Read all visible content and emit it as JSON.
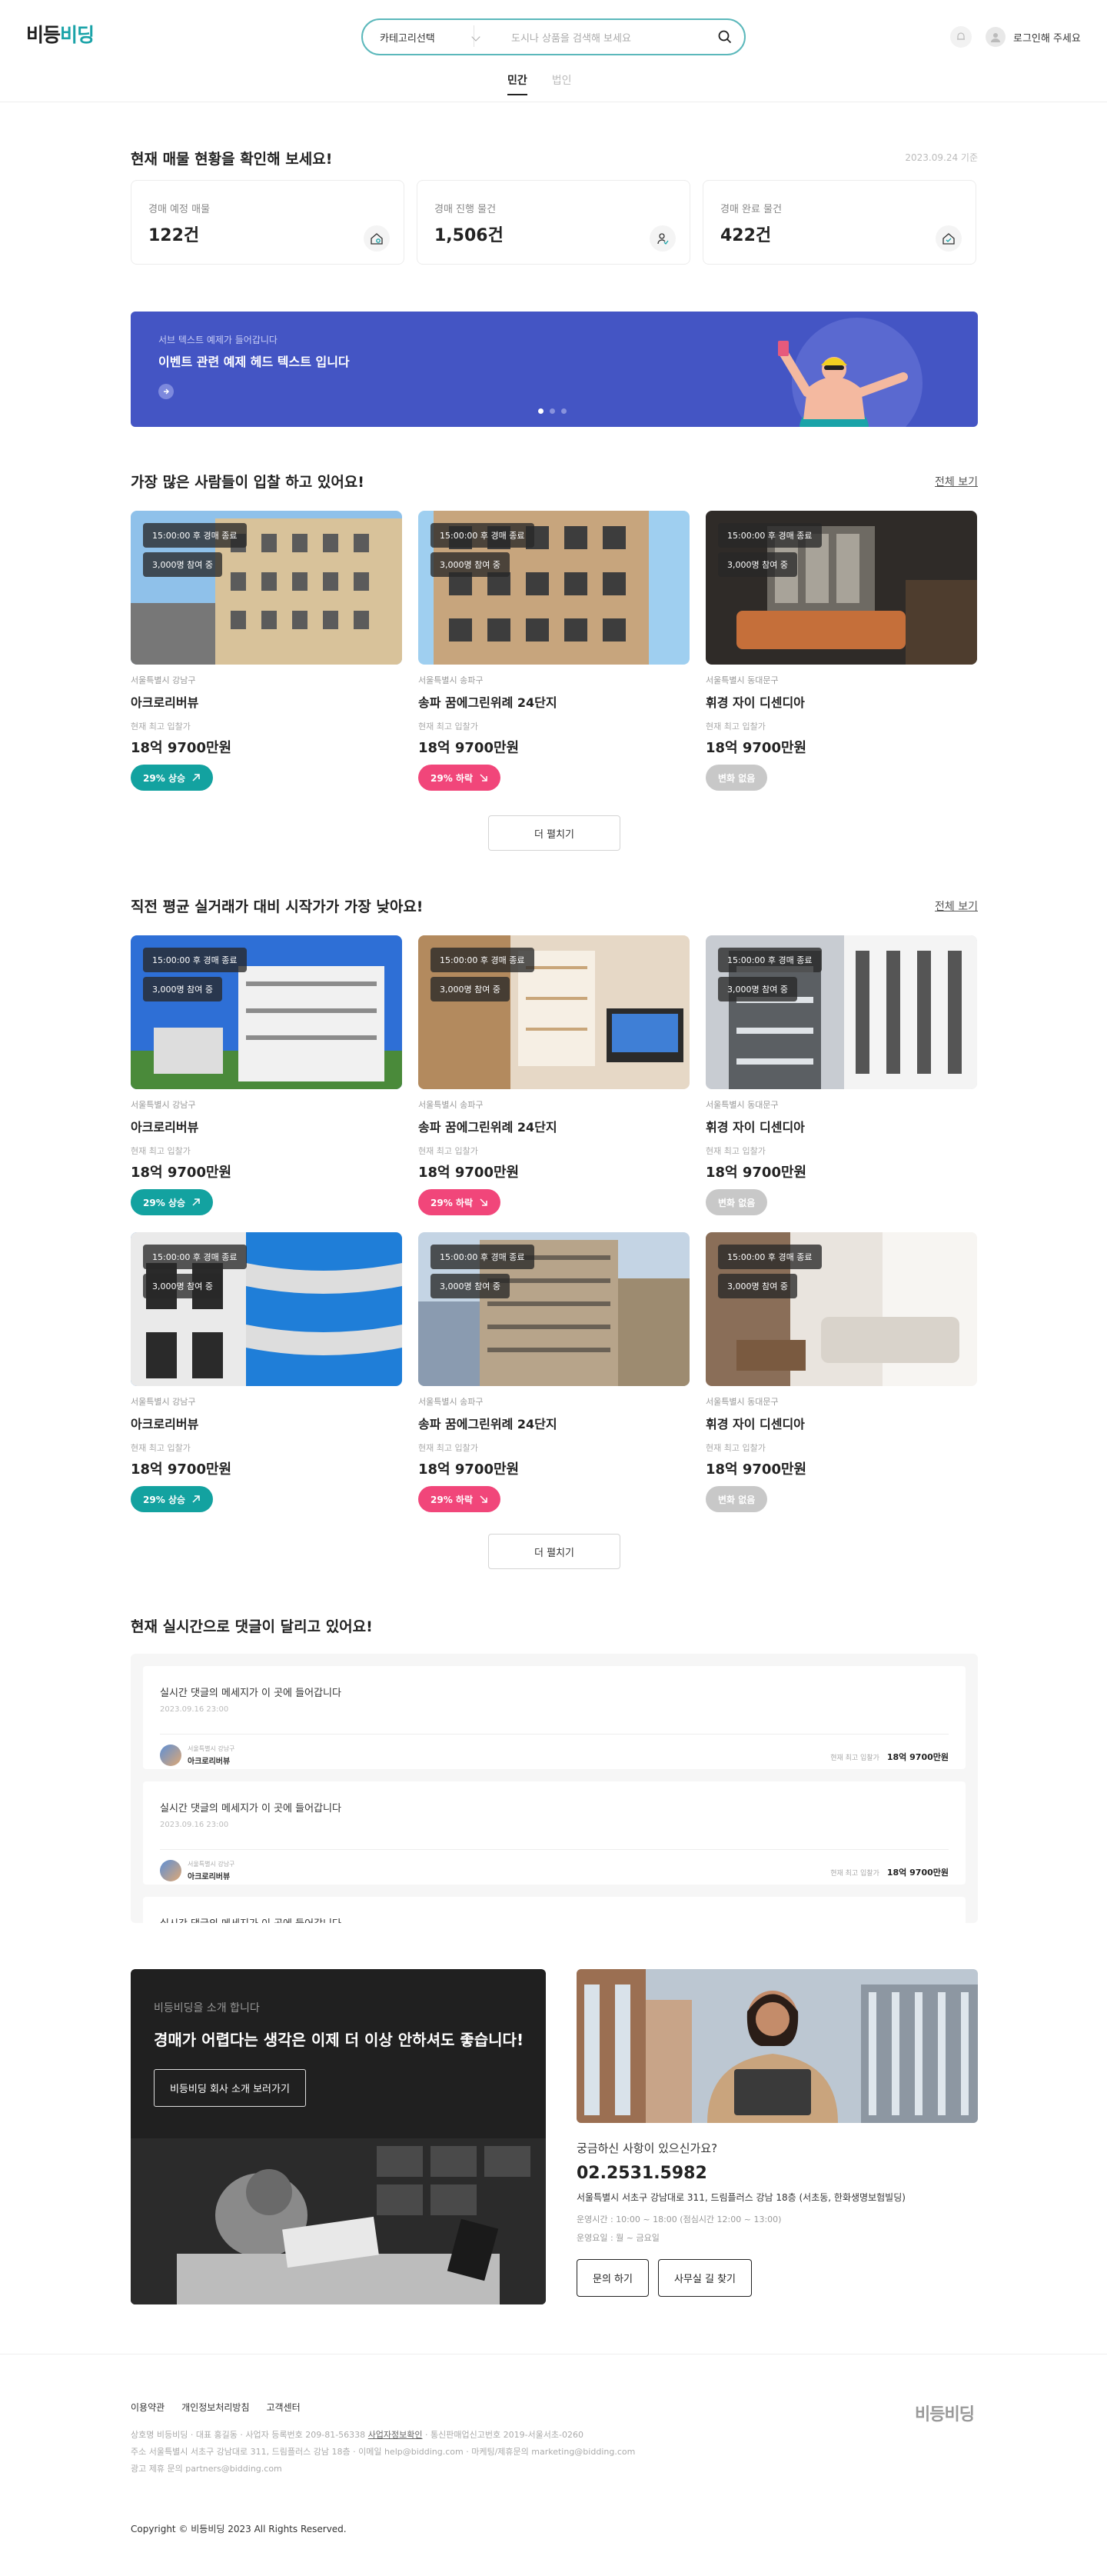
{
  "header": {
    "logo_left": "비등",
    "logo_right": "비딩",
    "category_label": "카테고리선택",
    "search_placeholder": "도시나 상품을 검색해 보세요",
    "login_label": "로그인해 주세요"
  },
  "tabs": [
    {
      "label": "민간",
      "active": true
    },
    {
      "label": "법인",
      "active": false
    }
  ],
  "stats": {
    "title": "현재 매물 현황을 확인해 보세요!",
    "date": "2023.09.24 기준",
    "cards": [
      {
        "label": "경매 예정 매물",
        "value": "122건",
        "icon": "house-search-icon"
      },
      {
        "label": "경매 진행 물건",
        "value": "1,506건",
        "icon": "user-check-icon"
      },
      {
        "label": "경매 완료 물건",
        "value": "422건",
        "icon": "house-check-icon"
      }
    ]
  },
  "banner": {
    "subtitle": "서브 텍스트 예제가 들어갑니다",
    "title": "이벤트 관련 예제 헤드 텍스트 입니다",
    "accent_color": "#4455c4"
  },
  "popular": {
    "title": "가장 많은 사람들이 입찰 하고 있어요!",
    "more": "전체 보기",
    "load_more": "더 펼치기",
    "items": [
      {
        "time": "15:00:00 후 경매 종료",
        "count": "3,000명 참여 중",
        "location": "서울특별시 강남구",
        "name": "아크로리버뷰",
        "price_label": "현재 최고 입찰가",
        "price": "18억 9700만원",
        "change": "29% 상승",
        "trend": "up"
      },
      {
        "time": "15:00:00 후 경매 종료",
        "count": "3,000명 참여 중",
        "location": "서울특별시 송파구",
        "name": "송파 꿈에그린위례 24단지",
        "price_label": "현재 최고 입찰가",
        "price": "18억 9700만원",
        "change": "29% 하락",
        "trend": "down"
      },
      {
        "time": "15:00:00 후 경매 종료",
        "count": "3,000명 참여 중",
        "location": "서울특별시 동대문구",
        "name": "휘경 자이 디센디아",
        "price_label": "현재 최고 입찰가",
        "price": "18억 9700만원",
        "change": "변화 없음",
        "trend": "none"
      }
    ]
  },
  "lowest": {
    "title": "직전 평균 실거래가 대비 시작가가 가장 낮아요!",
    "more": "전체 보기",
    "load_more": "더 펼치기",
    "items": [
      {
        "time": "15:00:00 후 경매 종료",
        "count": "3,000명 참여 중",
        "location": "서울특별시 강남구",
        "name": "아크로리버뷰",
        "price_label": "현재 최고 입찰가",
        "price": "18억 9700만원",
        "change": "29% 상승",
        "trend": "up"
      },
      {
        "time": "15:00:00 후 경매 종료",
        "count": "3,000명 참여 중",
        "location": "서울특별시 송파구",
        "name": "송파 꿈에그린위례 24단지",
        "price_label": "현재 최고 입찰가",
        "price": "18억 9700만원",
        "change": "29% 하락",
        "trend": "down"
      },
      {
        "time": "15:00:00 후 경매 종료",
        "count": "3,000명 참여 중",
        "location": "서울특별시 동대문구",
        "name": "휘경 자이 디센디아",
        "price_label": "현재 최고 입찰가",
        "price": "18억 9700만원",
        "change": "변화 없음",
        "trend": "none"
      },
      {
        "time": "15:00:00 후 경매 종료",
        "count": "3,000명 참여 중",
        "location": "서울특별시 강남구",
        "name": "아크로리버뷰",
        "price_label": "현재 최고 입찰가",
        "price": "18억 9700만원",
        "change": "29% 상승",
        "trend": "up"
      },
      {
        "time": "15:00:00 후 경매 종료",
        "count": "3,000명 참여 중",
        "location": "서울특별시 송파구",
        "name": "송파 꿈에그린위례 24단지",
        "price_label": "현재 최고 입찰가",
        "price": "18억 9700만원",
        "change": "29% 하락",
        "trend": "down"
      },
      {
        "time": "15:00:00 후 경매 종료",
        "count": "3,000명 참여 중",
        "location": "서울특별시 동대문구",
        "name": "휘경 자이 디센디아",
        "price_label": "현재 최고 입찰가",
        "price": "18억 9700만원",
        "change": "변화 없음",
        "trend": "none"
      }
    ]
  },
  "live": {
    "title": "현재 실시간으로 댓글이 달리고 있어요!",
    "comments": [
      {
        "text": "실시간 댓글의 메세지가 이 곳에 들어갑니다",
        "date": "2023.09.16 23:00",
        "user_location": "서울특별시 강남구",
        "user_name": "아크로리버뷰",
        "price_label": "현재 최고 입찰가",
        "price": "18억 9700만원"
      },
      {
        "text": "실시간 댓글의 메세지가 이 곳에 들어갑니다",
        "date": "2023.09.16 23:00",
        "user_location": "서울특별시 강남구",
        "user_name": "아크로리버뷰",
        "price_label": "현재 최고 입찰가",
        "price": "18억 9700만원"
      },
      {
        "text": "실시간 댓글의 메세지가 이 곳에 들어갑니다",
        "date": "",
        "user_location": "",
        "user_name": "",
        "price_label": "",
        "price": ""
      }
    ]
  },
  "intro": {
    "sub": "비등비딩을 소개 합니다",
    "headline": "경매가 어렵다는 생각은 이제 더 이상 안하셔도 좋습니다!",
    "button": "비등비딩 회사 소개 보러가기"
  },
  "contact": {
    "question": "궁금하신 사항이 있으신가요?",
    "phone": "02.2531.5982",
    "address": "서울특별시 서초구 강남대로 311, 드림플러스 강남 18층 (서초동, 한화생명보험빌딩)",
    "hours": "운영시간 : 10:00 ~ 18:00 (점심시간 12:00 ~ 13:00)",
    "days": "운영요일 : 월 ~ 금요일",
    "btn_inquiry": "문의 하기",
    "btn_map": "사무실 길 찾기"
  },
  "footer": {
    "links": [
      "이용약관",
      "개인정보처리방침",
      "고객센터"
    ],
    "logo": "비등비딩",
    "line1_a": "상호명 비등비딩  ·  대표 홍길동  ·  사업자 등록번호 209-81-56338",
    "line1_link": "사업자정보확인",
    "line1_b": "  ·  통신판매업신고번호 2019-서울서초-0260",
    "line2": "주소 서울특별시 서초구 강남대로 311, 드림플러스 강남 18층  ·  이메일 help@bidding.com  ·  마케팅/제휴문의 marketing@bidding.com",
    "line3": "광고 제휴 문의 partners@bidding.com",
    "copyright": "Copyright © 비등비딩 2023 All Rights Reserved."
  }
}
